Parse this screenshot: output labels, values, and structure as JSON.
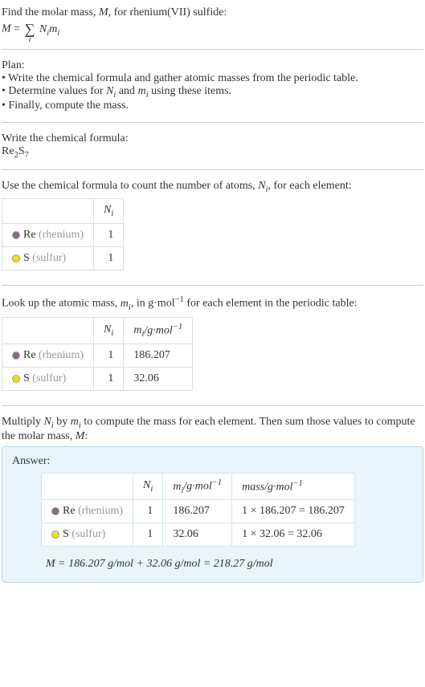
{
  "intro": {
    "line1": "Find the molar mass, ",
    "mvar": "M",
    "line1b": ", for rhenium(VII) sulfide:",
    "eq_lhs": "M",
    "eq_eq": " = ",
    "eq_rhs_term": "N",
    "eq_rhs_sub": "i",
    "eq_rhs_m": "m",
    "eq_rhs_msub": "i",
    "sigma_sub": "i"
  },
  "plan": {
    "heading": "Plan:",
    "b1": "• Write the chemical formula and gather atomic masses from the periodic table.",
    "b2_a": "• Determine values for ",
    "b2_n": "N",
    "b2_ni": "i",
    "b2_and": " and ",
    "b2_m": "m",
    "b2_mi": "i",
    "b2_end": " using these items.",
    "b3": "• Finally, compute the mass."
  },
  "step1": {
    "heading": "Write the chemical formula:",
    "formula_a": "Re",
    "formula_asub": "2",
    "formula_b": "S",
    "formula_bsub": "7"
  },
  "step2": {
    "heading_a": "Use the chemical formula to count the number of atoms, ",
    "heading_n": "N",
    "heading_ni": "i",
    "heading_b": ", for each element:",
    "col_n": "N",
    "col_ni": "i",
    "rows": [
      {
        "sym": "Re",
        "name": "(rhenium)",
        "n": "1"
      },
      {
        "sym": "S",
        "name": "(sulfur)",
        "n": "1"
      }
    ]
  },
  "step3": {
    "heading_a": "Look up the atomic mass, ",
    "heading_m": "m",
    "heading_mi": "i",
    "heading_b": ", in g·mol",
    "heading_exp": "−1",
    "heading_c": " for each element in the periodic table:",
    "col_n": "N",
    "col_ni": "i",
    "col_m": "m",
    "col_mi": "i",
    "col_unit": "/g·mol",
    "col_exp": "−1",
    "rows": [
      {
        "sym": "Re",
        "name": "(rhenium)",
        "n": "1",
        "mass": "186.207"
      },
      {
        "sym": "S",
        "name": "(sulfur)",
        "n": "1",
        "mass": "32.06"
      }
    ]
  },
  "step4": {
    "heading_a": "Multiply ",
    "heading_n": "N",
    "heading_ni": "i",
    "heading_b": " by ",
    "heading_m": "m",
    "heading_mi": "i",
    "heading_c": " to compute the mass for each element. Then sum those values to compute the molar mass, ",
    "heading_M": "M",
    "heading_d": ":"
  },
  "answer": {
    "label": "Answer:",
    "col_n": "N",
    "col_ni": "i",
    "col_m": "m",
    "col_mi": "i",
    "col_unit": "/g·mol",
    "col_exp": "−1",
    "col_mass": "mass/g·mol",
    "col_mass_exp": "−1",
    "rows": [
      {
        "sym": "Re",
        "name": "(rhenium)",
        "n": "1",
        "mass": "186.207",
        "calc": "1 × 186.207 = 186.207"
      },
      {
        "sym": "S",
        "name": "(sulfur)",
        "n": "1",
        "mass": "32.06",
        "calc": "1 × 32.06 = 32.06"
      }
    ],
    "final": "M = 186.207 g/mol + 32.06 g/mol = 218.27 g/mol"
  }
}
